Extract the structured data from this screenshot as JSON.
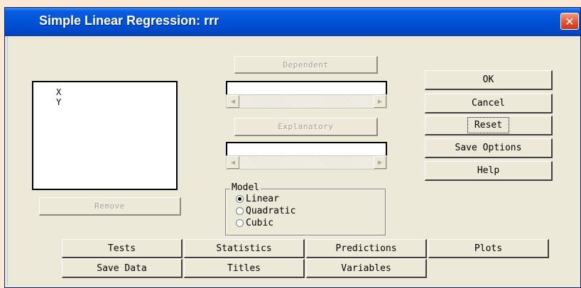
{
  "window": {
    "title": "Simple Linear Regression: rrr",
    "close_glyph": "✕"
  },
  "variables_list": [
    "X",
    "Y"
  ],
  "buttons": {
    "dependent": "Dependent",
    "explanatory": "Explanatory",
    "remove": "Remove",
    "ok": "OK",
    "cancel": "Cancel",
    "reset": "Reset",
    "save_options": "Save Options",
    "help": "Help"
  },
  "model": {
    "legend": "Model",
    "options": [
      "Linear",
      "Quadratic",
      "Cubic"
    ],
    "selected": "Linear"
  },
  "tabs": {
    "tests": "Tests",
    "statistics": "Statistics",
    "predictions": "Predictions",
    "plots": "Plots",
    "save_data": "Save Data",
    "titles": "Titles",
    "variables": "Variables"
  },
  "icons": {
    "scroll_left": "◀",
    "scroll_right": "▶"
  },
  "colors": {
    "titlebar": "#0052d6",
    "dialog_bg": "#ece9d8",
    "close": "#e0502c"
  }
}
